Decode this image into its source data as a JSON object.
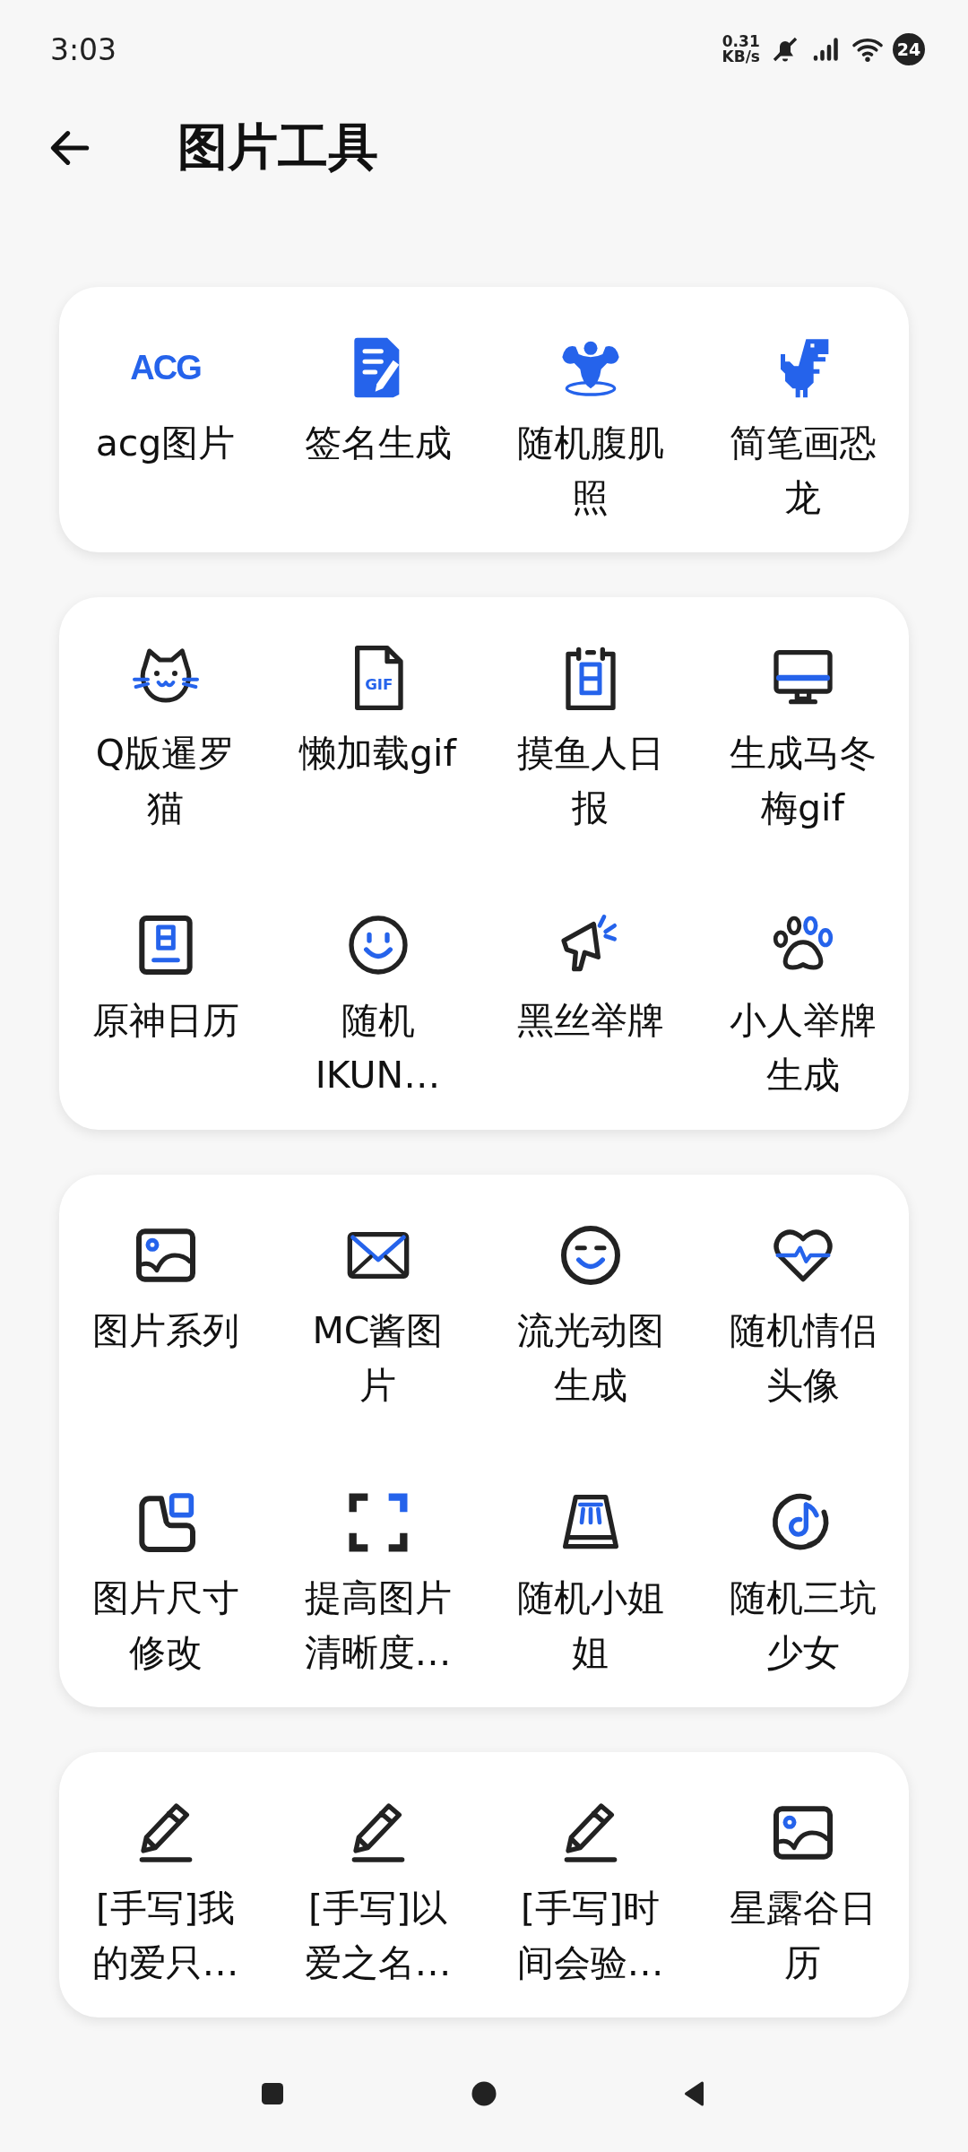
{
  "status_bar": {
    "time": "3:03",
    "net_speed": "0.31",
    "net_unit": "KB/s",
    "battery": "24"
  },
  "header": {
    "title": "图片工具"
  },
  "sections": [
    {
      "items": [
        {
          "label": "acg图片",
          "icon_text": "ACG"
        },
        {
          "label": "签名生成"
        },
        {
          "label": "随机腹肌照"
        },
        {
          "label": "简笔画恐龙"
        }
      ]
    },
    {
      "items": [
        {
          "label": "Q版暹罗猫"
        },
        {
          "label": "懒加载gif",
          "icon_text": "GIF"
        },
        {
          "label": "摸鱼人日报"
        },
        {
          "label": "生成马冬梅gif"
        },
        {
          "label": "原神日历"
        },
        {
          "label": "随机IKUN…"
        },
        {
          "label": "黑丝举牌"
        },
        {
          "label": "小人举牌生成"
        }
      ]
    },
    {
      "items": [
        {
          "label": "图片系列"
        },
        {
          "label": "MC酱图片"
        },
        {
          "label": "流光动图生成"
        },
        {
          "label": "随机情侣头像"
        },
        {
          "label": "图片尺寸修改"
        },
        {
          "label": "提高图片清晰度…"
        },
        {
          "label": "随机小姐姐"
        },
        {
          "label": "随机三坑少女"
        }
      ]
    },
    {
      "items": [
        {
          "label": "[手写]我的爱只…"
        },
        {
          "label": "[手写]以爱之名…"
        },
        {
          "label": "[手写]时间会验…"
        },
        {
          "label": "星露谷日历"
        }
      ]
    }
  ]
}
